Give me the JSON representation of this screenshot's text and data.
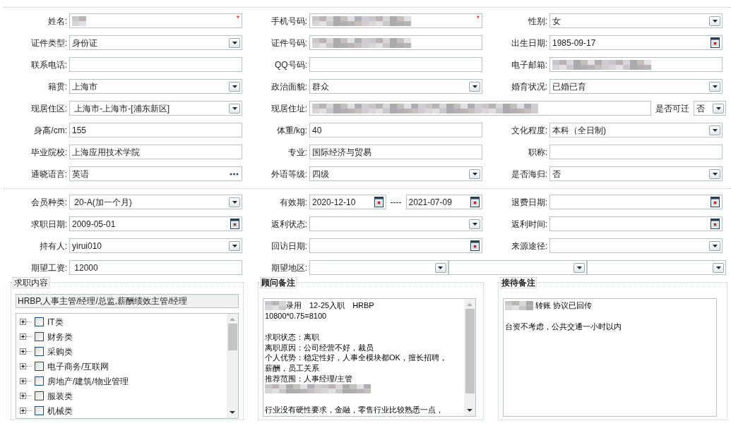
{
  "sections": [
    {
      "rows": [
        [
          {
            "label": "姓名:",
            "fields": [
              {
                "kind": "text",
                "redacted": true,
                "required_mark": "*"
              }
            ]
          },
          {
            "label": "手机号码:",
            "fields": [
              {
                "kind": "text",
                "redacted": true,
                "required_mark": "*"
              }
            ]
          },
          {
            "label": "性别:",
            "fields": [
              {
                "kind": "select",
                "value": "女"
              }
            ]
          }
        ],
        [
          {
            "label": "证件类型:",
            "fields": [
              {
                "kind": "select",
                "value": "身份证"
              }
            ]
          },
          {
            "label": "证件号码:",
            "fields": [
              {
                "kind": "text",
                "redacted": true
              }
            ]
          },
          {
            "label": "出生日期:",
            "fields": [
              {
                "kind": "date",
                "value": "1985-09-17"
              }
            ]
          }
        ],
        [
          {
            "label": "联系电话:",
            "fields": [
              {
                "kind": "text"
              }
            ]
          },
          {
            "label": "QQ号码:",
            "fields": [
              {
                "kind": "text"
              }
            ]
          },
          {
            "label": "电子邮箱:",
            "fields": [
              {
                "kind": "text",
                "redacted": true
              }
            ]
          }
        ],
        [
          {
            "label": "籍贯:",
            "fields": [
              {
                "kind": "select",
                "value": "上海市"
              }
            ]
          },
          {
            "label": "政治面貌:",
            "fields": [
              {
                "kind": "select",
                "value": "群众"
              }
            ]
          },
          {
            "label": "婚育状况:",
            "fields": [
              {
                "kind": "select",
                "value": "已婚已育"
              }
            ]
          }
        ],
        [
          {
            "label": "现居住区:",
            "fields": [
              {
                "kind": "select",
                "value": " 上海市-上海市-[浦东新区]"
              }
            ]
          },
          {
            "label": "现居住址:",
            "fields": [
              {
                "kind": "text",
                "redacted": true
              },
              {
                "kind": "inline-label",
                "value": "是否可迁"
              },
              {
                "kind": "mini-select",
                "value": "否"
              }
            ]
          }
        ],
        [
          {
            "label": "身高/cm:",
            "fields": [
              {
                "kind": "text",
                "value": "155"
              }
            ]
          },
          {
            "label": "体重/kg:",
            "fields": [
              {
                "kind": "text",
                "value": "40"
              }
            ]
          },
          {
            "label": "文化程度:",
            "fields": [
              {
                "kind": "select",
                "value": "本科（全日制)"
              }
            ]
          }
        ],
        [
          {
            "label": "毕业院校:",
            "fields": [
              {
                "kind": "text",
                "value": "上海应用技术学院"
              }
            ]
          },
          {
            "label": "专业:",
            "fields": [
              {
                "kind": "text",
                "value": "国际经济与贸易"
              }
            ]
          },
          {
            "label": "职称:",
            "fields": [
              {
                "kind": "text"
              }
            ]
          }
        ],
        [
          {
            "label": "通晓语言:",
            "fields": [
              {
                "kind": "picker",
                "value": "英语"
              }
            ]
          },
          {
            "label": "外语等级:",
            "fields": [
              {
                "kind": "select",
                "value": "四级"
              }
            ]
          },
          {
            "label": "是否海归:",
            "fields": [
              {
                "kind": "select",
                "value": "否"
              }
            ]
          }
        ]
      ]
    },
    {
      "rows": [
        [
          {
            "label": "会员种类:",
            "fields": [
              {
                "kind": "select",
                "value": " 20-A(加一个月)"
              }
            ]
          },
          {
            "label": "有效期:",
            "fields": [
              {
                "kind": "date",
                "value": "2020-12-10"
              },
              {
                "kind": "separator",
                "value": "----"
              },
              {
                "kind": "date",
                "value": "2021-07-09"
              }
            ]
          },
          {
            "label": "退费日期:",
            "fields": [
              {
                "kind": "date"
              }
            ]
          }
        ],
        [
          {
            "label": "求职日期:",
            "fields": [
              {
                "kind": "date",
                "value": "2009-05-01"
              }
            ]
          },
          {
            "label": "返利状态:",
            "fields": [
              {
                "kind": "select"
              }
            ]
          },
          {
            "label": "返利时间:",
            "fields": [
              {
                "kind": "date"
              }
            ]
          }
        ],
        [
          {
            "label": "持有人:",
            "fields": [
              {
                "kind": "select",
                "value": "yirui010"
              }
            ]
          },
          {
            "label": "回访日期:",
            "fields": [
              {
                "kind": "date"
              }
            ]
          },
          {
            "label": "来源途径:",
            "fields": [
              {
                "kind": "select"
              }
            ]
          }
        ],
        [
          {
            "label": "期望工资:",
            "fields": [
              {
                "kind": "text",
                "value": " 12000"
              }
            ]
          },
          {
            "label": "期望地区:",
            "fields": [
              {
                "kind": "select"
              },
              {
                "kind": "select"
              },
              {
                "kind": "select"
              }
            ]
          }
        ]
      ]
    }
  ],
  "job_intent": {
    "title": "求职内容",
    "summary": "HRBP,人事主管/经理/总监,薪酬绩效主管/经理",
    "items": [
      {
        "label": "IT类",
        "checked": false,
        "expanded": false
      },
      {
        "label": "财务类",
        "checked": false,
        "expanded": false
      },
      {
        "label": "采购类",
        "checked": false,
        "expanded": false
      },
      {
        "label": "电子商务/互联网",
        "checked": false,
        "expanded": false
      },
      {
        "label": "房地产/建筑/物业管理",
        "checked": false,
        "expanded": false
      },
      {
        "label": "服装类",
        "checked": false,
        "expanded": false
      },
      {
        "label": "机械类",
        "checked": false,
        "expanded": false
      }
    ]
  },
  "notes": [
    {
      "title": "顾问备注",
      "scrollbar": true,
      "lines": [
        {
          "kind": "text",
          "redacted_prefix": true,
          "text": "录用　12-25入职　HRBP"
        },
        {
          "kind": "text",
          "text": "10800*0.75=8100"
        },
        {
          "kind": "blank"
        },
        {
          "kind": "text",
          "text": "求职状态：离职"
        },
        {
          "kind": "text",
          "text": "离职原因：公司经营不好，裁员"
        },
        {
          "kind": "text",
          "text": "个人优势：稳定性好，人事全模块都OK，擅长招聘，"
        },
        {
          "kind": "text",
          "text": "薪酬，员工关系"
        },
        {
          "kind": "text",
          "text": "推荐范围：人事经理/主管"
        },
        {
          "kind": "redacted"
        },
        {
          "kind": "blank"
        },
        {
          "kind": "text",
          "text": "行业没有硬性要求，金融，零售行业比较熟悉一点，"
        }
      ]
    },
    {
      "title": "接待备注",
      "scrollbar": false,
      "lines": [
        {
          "kind": "text",
          "redacted_prefix": true,
          "text": " 转账 协议已回传"
        },
        {
          "kind": "blank"
        },
        {
          "kind": "text",
          "text": "台资不考虑，公共交通一小时以内"
        }
      ]
    }
  ]
}
